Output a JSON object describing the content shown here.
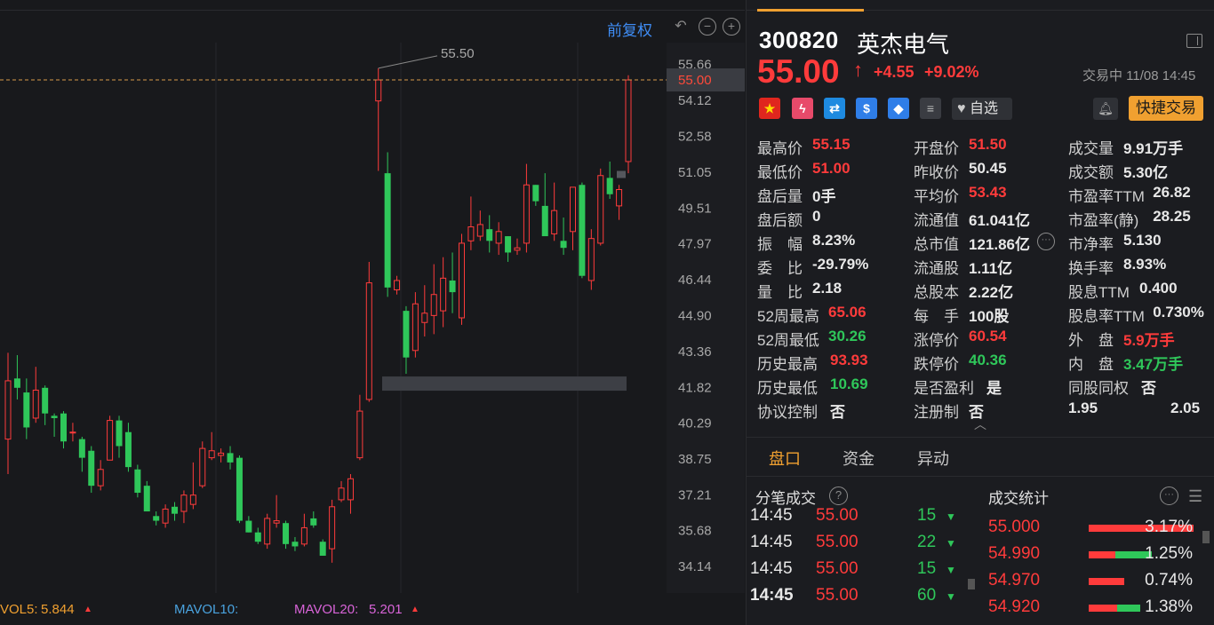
{
  "toolbar": {
    "adjust_label": "前复权"
  },
  "chart": {
    "price_ticks": [
      "55.66",
      "54.12",
      "52.58",
      "51.05",
      "49.51",
      "47.97",
      "46.44",
      "44.90",
      "43.36",
      "41.82",
      "40.29",
      "38.75",
      "37.21",
      "35.68",
      "34.14"
    ],
    "current_price_tag": "55.00",
    "high_marker_label": "55.50",
    "up_color": "#ff3b3b",
    "down_color": "#2fc75a"
  },
  "chart_data": {
    "type": "candlestick",
    "ylim": [
      33.0,
      56.6
    ],
    "y_ticks": [
      55.66,
      54.12,
      52.58,
      51.05,
      49.51,
      47.97,
      46.44,
      44.9,
      43.36,
      41.82,
      40.29,
      38.75,
      37.21,
      35.68,
      34.14
    ],
    "reference_line": 55.0,
    "annotation": {
      "label": "55.50",
      "value": 55.5
    },
    "candles": [
      {
        "o": 39.6,
        "h": 43.3,
        "l": 38.1,
        "c": 42.1
      },
      {
        "o": 42.2,
        "h": 43.2,
        "l": 41.3,
        "c": 41.8
      },
      {
        "o": 41.6,
        "h": 42.2,
        "l": 39.6,
        "c": 40.1
      },
      {
        "o": 40.5,
        "h": 42.7,
        "l": 40.3,
        "c": 41.7
      },
      {
        "o": 41.8,
        "h": 41.9,
        "l": 40.2,
        "c": 40.7
      },
      {
        "o": 40.6,
        "h": 40.7,
        "l": 39.7,
        "c": 40.5
      },
      {
        "o": 40.7,
        "h": 40.8,
        "l": 39.2,
        "c": 39.5
      },
      {
        "o": 39.9,
        "h": 40.3,
        "l": 39.5,
        "c": 39.9
      },
      {
        "o": 39.6,
        "h": 39.7,
        "l": 38.2,
        "c": 38.8
      },
      {
        "o": 39.1,
        "h": 39.3,
        "l": 37.3,
        "c": 37.6
      },
      {
        "o": 37.6,
        "h": 38.7,
        "l": 37.4,
        "c": 38.3
      },
      {
        "o": 38.7,
        "h": 40.6,
        "l": 38.7,
        "c": 40.4
      },
      {
        "o": 40.4,
        "h": 40.6,
        "l": 38.8,
        "c": 39.3
      },
      {
        "o": 39.9,
        "h": 40.3,
        "l": 38.2,
        "c": 38.4
      },
      {
        "o": 38.3,
        "h": 38.5,
        "l": 37.1,
        "c": 37.3
      },
      {
        "o": 37.6,
        "h": 37.8,
        "l": 36.6,
        "c": 36.5
      },
      {
        "o": 36.3,
        "h": 36.5,
        "l": 35.9,
        "c": 36.1
      },
      {
        "o": 36.0,
        "h": 36.8,
        "l": 35.8,
        "c": 36.6
      },
      {
        "o": 36.7,
        "h": 36.9,
        "l": 36.1,
        "c": 36.4
      },
      {
        "o": 36.5,
        "h": 37.4,
        "l": 36.0,
        "c": 37.2
      },
      {
        "o": 36.8,
        "h": 38.6,
        "l": 36.6,
        "c": 37.2
      },
      {
        "o": 37.6,
        "h": 39.5,
        "l": 37.5,
        "c": 39.2
      },
      {
        "o": 38.8,
        "h": 39.9,
        "l": 38.7,
        "c": 39.1
      },
      {
        "o": 38.9,
        "h": 39.2,
        "l": 38.6,
        "c": 39.0
      },
      {
        "o": 39.0,
        "h": 39.3,
        "l": 38.3,
        "c": 38.6
      },
      {
        "o": 38.8,
        "h": 38.9,
        "l": 36.0,
        "c": 36.1
      },
      {
        "o": 36.1,
        "h": 36.3,
        "l": 35.6,
        "c": 35.6
      },
      {
        "o": 35.6,
        "h": 35.8,
        "l": 35.1,
        "c": 35.2
      },
      {
        "o": 35.1,
        "h": 36.4,
        "l": 34.9,
        "c": 36.2
      },
      {
        "o": 36.0,
        "h": 37.2,
        "l": 35.8,
        "c": 36.1
      },
      {
        "o": 36.0,
        "h": 36.1,
        "l": 34.9,
        "c": 35.1
      },
      {
        "o": 35.2,
        "h": 35.4,
        "l": 34.8,
        "c": 35.0
      },
      {
        "o": 35.1,
        "h": 36.4,
        "l": 35.0,
        "c": 35.8
      },
      {
        "o": 36.2,
        "h": 36.5,
        "l": 35.8,
        "c": 35.9
      },
      {
        "o": 35.2,
        "h": 35.3,
        "l": 34.6,
        "c": 34.6
      },
      {
        "o": 34.9,
        "h": 37.0,
        "l": 34.3,
        "c": 36.7
      },
      {
        "o": 37.0,
        "h": 37.8,
        "l": 36.9,
        "c": 37.5
      },
      {
        "o": 37.0,
        "h": 38.1,
        "l": 36.4,
        "c": 37.9
      },
      {
        "o": 38.8,
        "h": 41.5,
        "l": 38.7,
        "c": 40.8
      },
      {
        "o": 41.3,
        "h": 47.2,
        "l": 41.2,
        "c": 46.3
      },
      {
        "o": 54.1,
        "h": 55.5,
        "l": 51.1,
        "c": 55.0
      },
      {
        "o": 51.0,
        "h": 51.9,
        "l": 45.7,
        "c": 46.1
      },
      {
        "o": 46.0,
        "h": 46.6,
        "l": 45.8,
        "c": 46.4
      },
      {
        "o": 45.1,
        "h": 45.3,
        "l": 42.4,
        "c": 43.1
      },
      {
        "o": 43.4,
        "h": 45.9,
        "l": 43.1,
        "c": 45.4
      },
      {
        "o": 44.6,
        "h": 46.2,
        "l": 44.0,
        "c": 45.0
      },
      {
        "o": 44.9,
        "h": 47.1,
        "l": 44.1,
        "c": 45.8
      },
      {
        "o": 45.1,
        "h": 47.4,
        "l": 44.4,
        "c": 46.5
      },
      {
        "o": 46.4,
        "h": 47.6,
        "l": 45.0,
        "c": 45.9
      },
      {
        "o": 44.8,
        "h": 48.4,
        "l": 44.5,
        "c": 48.0
      },
      {
        "o": 48.1,
        "h": 50.0,
        "l": 47.7,
        "c": 48.7
      },
      {
        "o": 48.3,
        "h": 49.4,
        "l": 48.1,
        "c": 48.8
      },
      {
        "o": 48.6,
        "h": 49.2,
        "l": 47.6,
        "c": 48.1
      },
      {
        "o": 48.0,
        "h": 48.9,
        "l": 47.5,
        "c": 48.5
      },
      {
        "o": 48.3,
        "h": 48.3,
        "l": 47.2,
        "c": 47.6
      },
      {
        "o": 47.7,
        "h": 48.2,
        "l": 47.5,
        "c": 47.8
      },
      {
        "o": 48.0,
        "h": 51.4,
        "l": 47.6,
        "c": 50.5
      },
      {
        "o": 50.5,
        "h": 50.5,
        "l": 49.6,
        "c": 49.8
      },
      {
        "o": 49.6,
        "h": 51.0,
        "l": 49.1,
        "c": 48.3
      },
      {
        "o": 48.4,
        "h": 50.6,
        "l": 48.1,
        "c": 49.4
      },
      {
        "o": 48.1,
        "h": 49.1,
        "l": 47.5,
        "c": 47.8
      },
      {
        "o": 48.5,
        "h": 49.8,
        "l": 47.7,
        "c": 50.4
      },
      {
        "o": 50.5,
        "h": 50.6,
        "l": 46.5,
        "c": 46.6
      },
      {
        "o": 46.4,
        "h": 48.6,
        "l": 46.0,
        "c": 48.2
      },
      {
        "o": 48.0,
        "h": 51.2,
        "l": 47.9,
        "c": 50.9
      },
      {
        "o": 50.8,
        "h": 51.5,
        "l": 49.9,
        "c": 50.1
      },
      {
        "o": 49.6,
        "h": 50.5,
        "l": 49.0,
        "c": 50.3
      },
      {
        "o": 51.5,
        "h": 55.2,
        "l": 51.0,
        "c": 55.0
      }
    ]
  },
  "volume": {
    "ma5_label": "VOL5:",
    "ma5_value": "5.844",
    "ma10_label": "MAVOL10:",
    "ma20_label": "MAVOL20:",
    "ma20_value": "5.201"
  },
  "quote": {
    "code": "300820",
    "name": "英杰电气",
    "price": "55.00",
    "change": "+4.55",
    "change_pct": "+9.02%",
    "status": "交易中 11/08 14:45",
    "watch_label": "自选",
    "quick_trade_label": "快捷交易",
    "tags": [
      "flag",
      "margin",
      "connect",
      "dollar",
      "tag",
      "note"
    ],
    "grid": [
      [
        {
          "l": "最高价",
          "v": "55.15",
          "c": "red"
        },
        {
          "l": "开盘价",
          "v": "51.50",
          "c": "red"
        },
        {
          "l": "成交量",
          "v": "9.91万手",
          "c": "white"
        }
      ],
      [
        {
          "l": "最低价",
          "v": "51.00",
          "c": "red"
        },
        {
          "l": "昨收价",
          "v": "50.45",
          "c": "white"
        },
        {
          "l": "成交额",
          "v": "5.30亿",
          "c": "white"
        }
      ],
      [
        {
          "l": "盘后量",
          "v": "0手",
          "c": "white"
        },
        {
          "l": "平均价",
          "v": "53.43",
          "c": "red"
        },
        {
          "l": "市盈率TTM",
          "v": "26.82",
          "c": "white"
        }
      ],
      [
        {
          "l": "盘后额",
          "v": "0",
          "c": "white"
        },
        {
          "l": "流通值",
          "v": "61.041亿",
          "c": "white"
        },
        {
          "l": "市盈率(静)",
          "v": "28.25",
          "c": "white"
        }
      ],
      [
        {
          "l": "振　幅",
          "v": "8.23%",
          "c": "white"
        },
        {
          "l": "总市值",
          "v": "121.86亿",
          "c": "white"
        },
        {
          "l": "市净率",
          "v": "5.130",
          "c": "white"
        }
      ],
      [
        {
          "l": "委　比",
          "v": "-29.79%",
          "c": "white"
        },
        {
          "l": "流通股",
          "v": "1.11亿",
          "c": "white"
        },
        {
          "l": "换手率",
          "v": "8.93%",
          "c": "white"
        }
      ],
      [
        {
          "l": "量　比",
          "v": "2.18",
          "c": "white"
        },
        {
          "l": "总股本",
          "v": "2.22亿",
          "c": "white"
        },
        {
          "l": "股息TTM",
          "v": "0.400",
          "c": "white"
        }
      ],
      [
        {
          "l": "52周最高",
          "v": "65.06",
          "c": "red"
        },
        {
          "l": "每　手",
          "v": "100股",
          "c": "white"
        },
        {
          "l": "股息率TTM",
          "v": "0.730%",
          "c": "white"
        }
      ],
      [
        {
          "l": "52周最低",
          "v": "30.26",
          "c": "green"
        },
        {
          "l": "涨停价",
          "v": "60.54",
          "c": "red"
        },
        {
          "l": "外　盘",
          "v": "5.9万手",
          "c": "red"
        }
      ],
      [
        {
          "l": "历史最高",
          "v": "93.93",
          "c": "red"
        },
        {
          "l": "跌停价",
          "v": "40.36",
          "c": "green"
        },
        {
          "l": "内　盘",
          "v": "3.47万手",
          "c": "green"
        }
      ],
      [
        {
          "l": "历史最低",
          "v": "10.69",
          "c": "green"
        },
        {
          "l": "是否盈利",
          "v": "是",
          "c": "white"
        },
        {
          "l": "同股同权",
          "v": "否",
          "c": "white"
        }
      ],
      [
        {
          "l": "协议控制",
          "v": "否",
          "c": "white"
        },
        {
          "l": "注册制",
          "v": "否",
          "c": "white"
        },
        {
          "l": "",
          "v": "1.95",
          "c": "white",
          "v2": "2.05"
        }
      ]
    ]
  },
  "subtabs": [
    "盘口",
    "资金",
    "异动"
  ],
  "ticks": {
    "title": "分笔成交",
    "rows": [
      {
        "time": "14:45",
        "price": "55.00",
        "vol": "15"
      },
      {
        "time": "14:45",
        "price": "55.00",
        "vol": "22"
      },
      {
        "time": "14:45",
        "price": "55.00",
        "vol": "15"
      },
      {
        "time": "14:45",
        "price": "55.00",
        "vol": "60"
      }
    ]
  },
  "stats": {
    "title": "成交统计",
    "rows": [
      {
        "price": "55.000",
        "pct": "3.17%",
        "red": 1.0,
        "green": 0.0
      },
      {
        "price": "54.990",
        "pct": "1.25%",
        "red": 0.25,
        "green": 0.35
      },
      {
        "price": "54.970",
        "pct": "0.74%",
        "red": 0.34,
        "green": 0.0
      },
      {
        "price": "54.920",
        "pct": "1.38%",
        "red": 0.27,
        "green": 0.22
      }
    ]
  }
}
